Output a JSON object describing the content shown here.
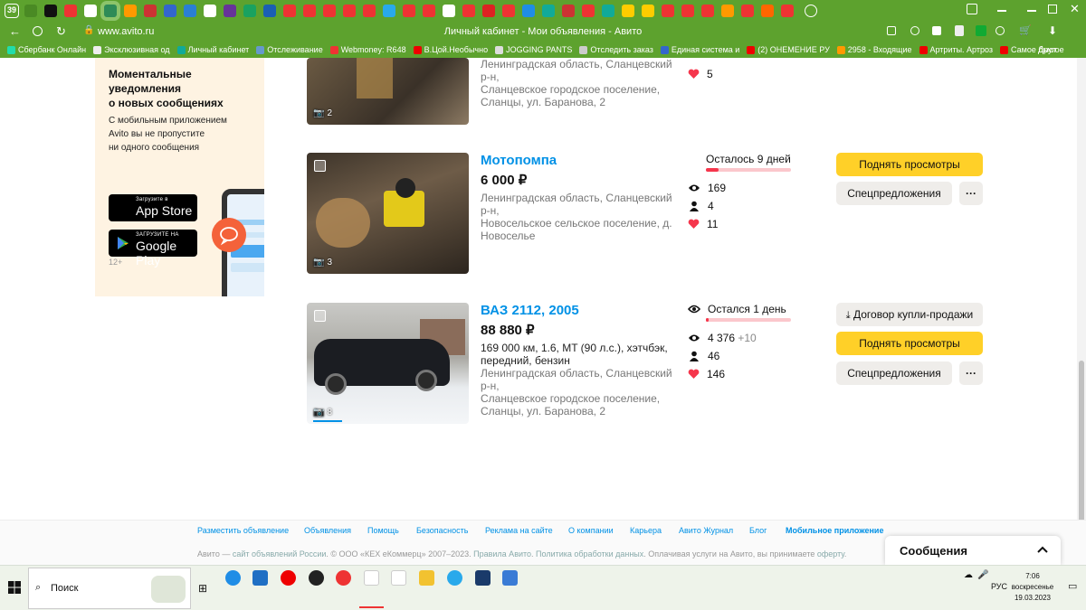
{
  "browser": {
    "tab_count": "39",
    "url": "www.avito.ru",
    "page_title": "Личный кабинет - Мои объявления - Авито",
    "bookmarks": [
      "Сбербанк Онлайн",
      "Эксклюзивная од",
      "Личный кабинет",
      "Отслеживание",
      "Webmoney: R648",
      "В.Цой.Необычно",
      "JOGGING PANTS",
      "Отследить заказ",
      "Единая система и",
      "(2) ОНЕМЕНИЕ РУ",
      "2958 - Входящие",
      "Артриты. Артроз",
      "Самое быст"
    ],
    "bookmarks_more": "Другое"
  },
  "promo": {
    "title_lines": [
      "Моментальные",
      "уведомления",
      "о новых сообщениях"
    ],
    "text_lines": [
      "С мобильным приложением",
      "Avito вы не пропустите",
      "ни одного сообщения"
    ],
    "appstore_small": "Загрузите в",
    "appstore_big": "App Store",
    "googleplay_small": "ЗАГРУЗИТЕ НА",
    "googleplay_big": "Google Play",
    "age": "12+"
  },
  "listings": [
    {
      "address_lines": [
        "Ленинградская область, Сланцевский р-н,",
        "Сланцевское городское поселение,",
        "Сланцы, ул. Баранова, 2"
      ],
      "photos": "2",
      "likes": "5"
    },
    {
      "title": "Мотопомпа",
      "price": "6 000 ₽",
      "address_lines": [
        "Ленинградская область, Сланцевский р-н,",
        "Новосельское сельское поселение, д.",
        "Новоселье"
      ],
      "photos": "3",
      "remaining": "Осталось 9 дней",
      "remaining_fraction": 0.15,
      "views": "169",
      "contacts": "4",
      "likes": "11",
      "promote_label": "Поднять просмотры",
      "special_label": "Спецпредложения",
      "more_label": "···"
    },
    {
      "title": "ВАЗ 2112, 2005",
      "price": "88 880 ₽",
      "desc_lines": [
        "169 000 км, 1.6, MT (90 л.с.), хэтчбэк,",
        "передний, бензин"
      ],
      "address_lines": [
        "Ленинградская область, Сланцевский р-н,",
        "Сланцевское городское поселение,",
        "Сланцы, ул. Баранова, 2"
      ],
      "photos": "8",
      "remaining": "Остался 1 день",
      "remaining_fraction": 0.03,
      "views": "4 376",
      "views_delta": "+10",
      "contacts": "46",
      "likes": "146",
      "contract_label": "Договор купли-продажи",
      "promote_label": "Поднять просмотры",
      "special_label": "Спецпредложения",
      "more_label": "···"
    }
  ],
  "footer": {
    "links": [
      "Разместить объявление",
      "Объявления",
      "Помощь",
      "Безопасность",
      "Реклама на сайте",
      "О компании",
      "Карьера",
      "Авито Журнал",
      "Блог",
      "Мобильное приложение"
    ],
    "copy_start": "Авито — ",
    "copy_link1": "сайт объявлений России",
    "copy_mid": ". © ООО «КЕХ еКоммерц» 2007–2023. ",
    "copy_link2": "Правила Авито",
    "copy_sep": ". ",
    "copy_link3": "Политика обработки данных",
    "copy_end": ". Оплачивая услуги на Авито, вы принимаете ",
    "copy_link4": "оферту",
    "copy_dot": "."
  },
  "messages": {
    "label": "Сообщения"
  },
  "taskbar": {
    "search_placeholder": "Поиск",
    "lang": "РУС",
    "time": "7:06",
    "day": "воскресенье",
    "date": "19.03.2023"
  },
  "colors": {
    "brand_green": "#5da22e",
    "link_blue": "#0091e6",
    "promote_yellow": "#ffd028",
    "heart_red": "#f5364c"
  }
}
